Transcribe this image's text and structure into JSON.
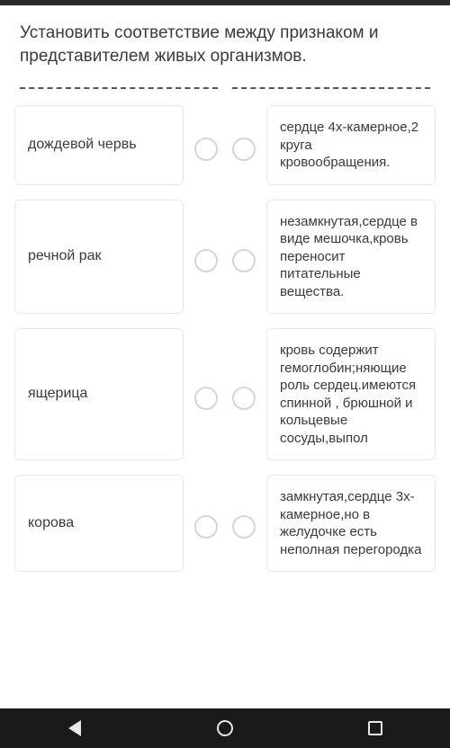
{
  "question": "Установить соответствие между признаком и представителем живых организмов.",
  "leftItems": [
    "дождевой червь",
    "речной рак",
    "ящерица",
    "корова"
  ],
  "rightItems": [
    "сердце 4х-камерное,2 круга кровообращения.",
    "незамкнутая,сердце в виде мешочка,кровь переносит питательные вещества.",
    "кровь содержит гемоглобин;няющие роль сердец.имеются спинной , брюшной и кольцевые сосуды,выпол",
    "замкнутая,сердце 3х-камерное,но в желудочке есть неполная перегородка"
  ]
}
